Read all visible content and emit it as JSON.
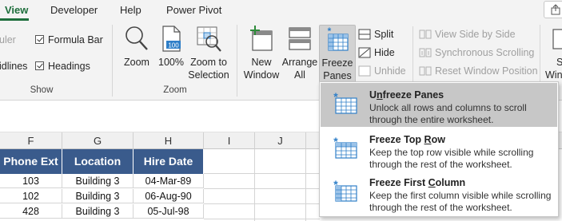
{
  "tabs": [
    {
      "label": "View",
      "active": true
    },
    {
      "label": "Developer",
      "active": false
    },
    {
      "label": "Help",
      "active": false
    },
    {
      "label": "Power Pivot",
      "active": false
    }
  ],
  "ribbon": {
    "show_group": {
      "label": "Show",
      "ruler": "uler",
      "gridlines": "idlines",
      "formula_bar": "Formula Bar",
      "headings": "Headings"
    },
    "zoom_group": {
      "label": "Zoom",
      "zoom": "Zoom",
      "hundred": "100%",
      "hundred_icon": "100",
      "zoom_sel_line1": "Zoom to",
      "zoom_sel_line2": "Selection"
    },
    "window_group": {
      "new_window_line1": "New",
      "new_window_line2": "Window",
      "arrange_line1": "Arrange",
      "arrange_line2": "All",
      "freeze_line1": "Freeze",
      "freeze_line2": "Panes",
      "freeze_caret": "⌄",
      "split": "Split",
      "hide": "Hide",
      "unhide": "Unhide",
      "side_by_side": "View Side by Side",
      "sync_scroll": "Synchronous Scrolling",
      "reset_pos": "Reset Window Position",
      "next_partial_1": "S",
      "next_partial_2": "Win"
    }
  },
  "sheet": {
    "columns": [
      "F",
      "G",
      "H",
      "I",
      "J"
    ],
    "headers": [
      "Phone Ext",
      "Location",
      "Hire Date"
    ],
    "rows": [
      [
        "103",
        "Building 3",
        "04-Mar-89"
      ],
      [
        "102",
        "Building 3",
        "06-Aug-90"
      ],
      [
        "428",
        "Building 3",
        "05-Jul-98"
      ]
    ]
  },
  "menu": {
    "items": [
      {
        "title_pre": "U",
        "title_ul": "n",
        "title_post": "freeze Panes",
        "desc": "Unlock all rows and columns to scroll through the entire worksheet.",
        "highlighted": true
      },
      {
        "title_pre": "Freeze Top ",
        "title_ul": "R",
        "title_post": "ow",
        "desc": "Keep the top row visible while scrolling through the rest of the worksheet.",
        "highlighted": false
      },
      {
        "title_pre": "Freeze First ",
        "title_ul": "C",
        "title_post": "olumn",
        "desc": "Keep the first column visible while scrolling through the rest of the worksheet.",
        "highlighted": false
      }
    ]
  },
  "icons": {
    "freeze_icon": "freeze-panes-icon",
    "snowflake": "*"
  },
  "colors": {
    "accent": "#1e6e3c",
    "header_fill": "#3a5b8c",
    "menu_highlight": "#c7c7c7",
    "freeze_blue": "#2f7fc8"
  }
}
